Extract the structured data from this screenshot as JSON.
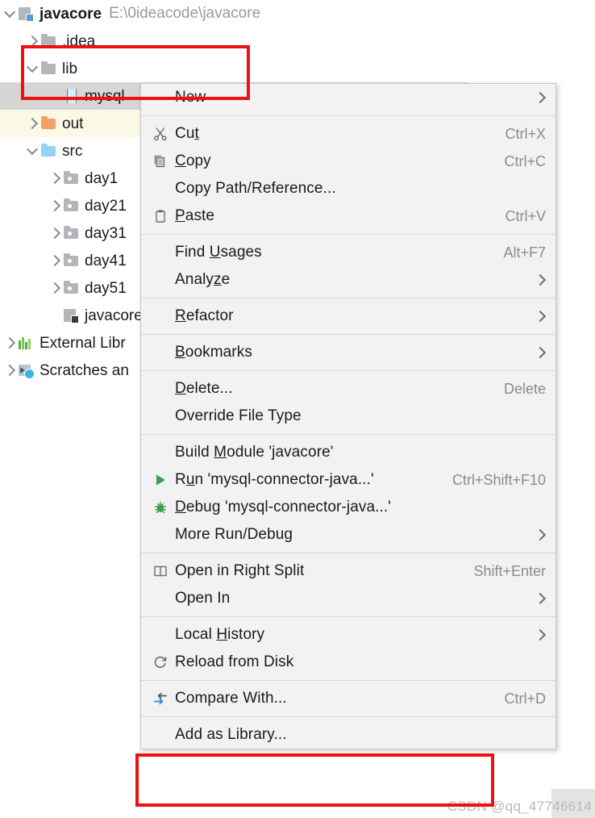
{
  "project_tree": {
    "rows": [
      {
        "id": "javacore",
        "label": "javacore",
        "detail": "E:\\0ideacode\\javacore",
        "arrow": "down",
        "icon": "module-icon",
        "indent": 0,
        "bold": true,
        "state": "normal"
      },
      {
        "id": "idea",
        "label": ".idea",
        "detail": "",
        "arrow": "right",
        "icon": "folder-gray-icon",
        "indent": 1,
        "bold": false,
        "state": "normal"
      },
      {
        "id": "lib",
        "label": "lib",
        "detail": "",
        "arrow": "down",
        "icon": "folder-gray-icon",
        "indent": 1,
        "bold": false,
        "state": "normal"
      },
      {
        "id": "mysql",
        "label": "mysql",
        "detail": "",
        "arrow": "none",
        "icon": "jar-icon",
        "indent": 2,
        "bold": false,
        "state": "selected"
      },
      {
        "id": "out",
        "label": "out",
        "detail": "",
        "arrow": "right",
        "icon": "folder-orange-icon",
        "indent": 1,
        "bold": false,
        "state": "highlighted"
      },
      {
        "id": "src",
        "label": "src",
        "detail": "",
        "arrow": "down",
        "icon": "folder-blue-icon",
        "indent": 1,
        "bold": false,
        "state": "normal"
      },
      {
        "id": "day1",
        "label": "day1",
        "detail": "",
        "arrow": "right",
        "icon": "package-folder-icon",
        "indent": 2,
        "bold": false,
        "state": "normal"
      },
      {
        "id": "day21",
        "label": "day21",
        "detail": "",
        "arrow": "right",
        "icon": "package-folder-icon",
        "indent": 2,
        "bold": false,
        "state": "normal"
      },
      {
        "id": "day31",
        "label": "day31",
        "detail": "",
        "arrow": "right",
        "icon": "package-folder-icon",
        "indent": 2,
        "bold": false,
        "state": "normal"
      },
      {
        "id": "day41",
        "label": "day41",
        "detail": "",
        "arrow": "right",
        "icon": "package-folder-icon",
        "indent": 2,
        "bold": false,
        "state": "normal"
      },
      {
        "id": "day51",
        "label": "day51",
        "detail": "",
        "arrow": "right",
        "icon": "package-folder-icon",
        "indent": 2,
        "bold": false,
        "state": "normal"
      },
      {
        "id": "javacore-iml",
        "label": "javacore.",
        "detail": "",
        "arrow": "none",
        "icon": "iml-file-icon",
        "indent": 2,
        "bold": false,
        "state": "normal"
      },
      {
        "id": "external-libraries",
        "label": "External Libr",
        "detail": "",
        "arrow": "right",
        "icon": "external-libraries-icon",
        "indent": 0,
        "bold": false,
        "state": "normal"
      },
      {
        "id": "scratches",
        "label": "Scratches an",
        "detail": "",
        "arrow": "right",
        "icon": "scratches-icon",
        "indent": 0,
        "bold": false,
        "state": "normal"
      }
    ]
  },
  "context_menu": {
    "groups": [
      [
        {
          "label": "New",
          "underline": "",
          "icon": "",
          "shortcut": "",
          "submenu": true
        }
      ],
      [
        {
          "label": "Cut",
          "underline": "t",
          "icon": "cut-icon",
          "shortcut": "Ctrl+X",
          "submenu": false
        },
        {
          "label": "Copy",
          "underline": "C",
          "icon": "copy-icon",
          "shortcut": "Ctrl+C",
          "submenu": false
        },
        {
          "label": "Copy Path/Reference...",
          "underline": "",
          "icon": "",
          "shortcut": "",
          "submenu": false
        },
        {
          "label": "Paste",
          "underline": "P",
          "icon": "paste-icon",
          "shortcut": "Ctrl+V",
          "submenu": false
        }
      ],
      [
        {
          "label": "Find Usages",
          "underline": "U",
          "icon": "",
          "shortcut": "Alt+F7",
          "submenu": false
        },
        {
          "label": "Analyze",
          "underline": "z",
          "icon": "",
          "shortcut": "",
          "submenu": true
        }
      ],
      [
        {
          "label": "Refactor",
          "underline": "R",
          "icon": "",
          "shortcut": "",
          "submenu": true
        }
      ],
      [
        {
          "label": "Bookmarks",
          "underline": "B",
          "icon": "",
          "shortcut": "",
          "submenu": true
        }
      ],
      [
        {
          "label": "Delete...",
          "underline": "D",
          "icon": "",
          "shortcut": "Delete",
          "submenu": false
        },
        {
          "label": "Override File Type",
          "underline": "",
          "icon": "",
          "shortcut": "",
          "submenu": false
        }
      ],
      [
        {
          "label": "Build Module 'javacore'",
          "underline": "M",
          "icon": "",
          "shortcut": "",
          "submenu": false
        },
        {
          "label": "Run 'mysql-connector-java...'",
          "underline": "u",
          "icon": "run-icon",
          "shortcut": "Ctrl+Shift+F10",
          "submenu": false
        },
        {
          "label": "Debug 'mysql-connector-java...'",
          "underline": "D",
          "icon": "debug-icon",
          "shortcut": "",
          "submenu": false
        },
        {
          "label": "More Run/Debug",
          "underline": "",
          "icon": "",
          "shortcut": "",
          "submenu": true
        }
      ],
      [
        {
          "label": "Open in Right Split",
          "underline": "",
          "icon": "split-icon",
          "shortcut": "Shift+Enter",
          "submenu": false
        },
        {
          "label": "Open In",
          "underline": "",
          "icon": "",
          "shortcut": "",
          "submenu": true
        }
      ],
      [
        {
          "label": "Local History",
          "underline": "H",
          "icon": "",
          "shortcut": "",
          "submenu": true
        },
        {
          "label": "Reload from Disk",
          "underline": "",
          "icon": "reload-icon",
          "shortcut": "",
          "submenu": false
        }
      ],
      [
        {
          "label": "Compare With...",
          "underline": "",
          "icon": "compare-icon",
          "shortcut": "Ctrl+D",
          "submenu": false
        }
      ],
      [
        {
          "label": "Add as Library...",
          "underline": "",
          "icon": "",
          "shortcut": "",
          "submenu": false
        }
      ]
    ]
  },
  "annotations": {
    "highlight_boxes": [
      {
        "id": "lib-mysql-highlight",
        "color": "#ee1111"
      },
      {
        "id": "add-as-library-highlight",
        "color": "#ee1111"
      }
    ]
  },
  "watermark": {
    "text": "CSDN @qq_47746614"
  },
  "colors": {
    "menu_bg": "#f2f2f2",
    "selection": "#d6d6d6",
    "highlight_row": "#fbf8e6",
    "annotation_red": "#ee1111",
    "shortcut_gray": "#8c8c8c"
  }
}
